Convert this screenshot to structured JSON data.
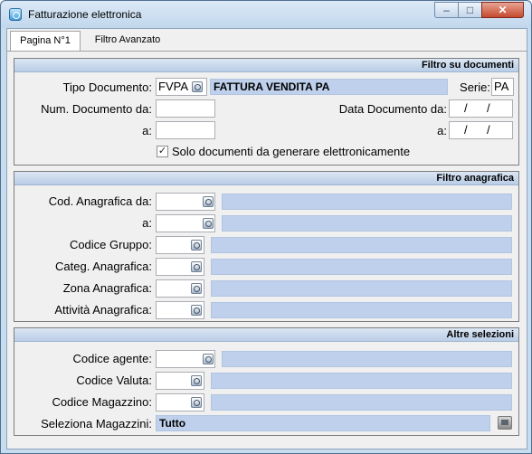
{
  "window": {
    "title": "Fatturazione elettronica",
    "minimize": "–",
    "maximize": "□",
    "close": "✕"
  },
  "tabs": [
    "Pagina N°1",
    "Filtro Avanzato"
  ],
  "documenti": {
    "header": "Filtro su documenti",
    "tipo_label": "Tipo Documento:",
    "tipo_value": "FVPA",
    "tipo_descr": "FATTURA VENDITA PA",
    "serie_label": "Serie:",
    "serie_value": "PA",
    "num_da_label": "Num. Documento da:",
    "num_a_label": "a:",
    "data_da_label": "Data Documento da:",
    "data_a_label": "a:",
    "date_sep": "/",
    "checkbox_label": "Solo documenti da generare elettronicamente",
    "checkbox_checked": true
  },
  "anagrafica": {
    "header": "Filtro anagrafica",
    "cod_da_label": "Cod. Anagrafica da:",
    "cod_a_label": "a:",
    "gruppo_label": "Codice Gruppo:",
    "categ_label": "Categ. Anagrafica:",
    "zona_label": "Zona Anagrafica:",
    "attivita_label": "Attività Anagrafica:"
  },
  "altre": {
    "header": "Altre selezioni",
    "agente_label": "Codice agente:",
    "valuta_label": "Codice Valuta:",
    "magazzino_label": "Codice Magazzino:",
    "seleziona_label": "Seleziona Magazzini:",
    "seleziona_value": "Tutto"
  }
}
